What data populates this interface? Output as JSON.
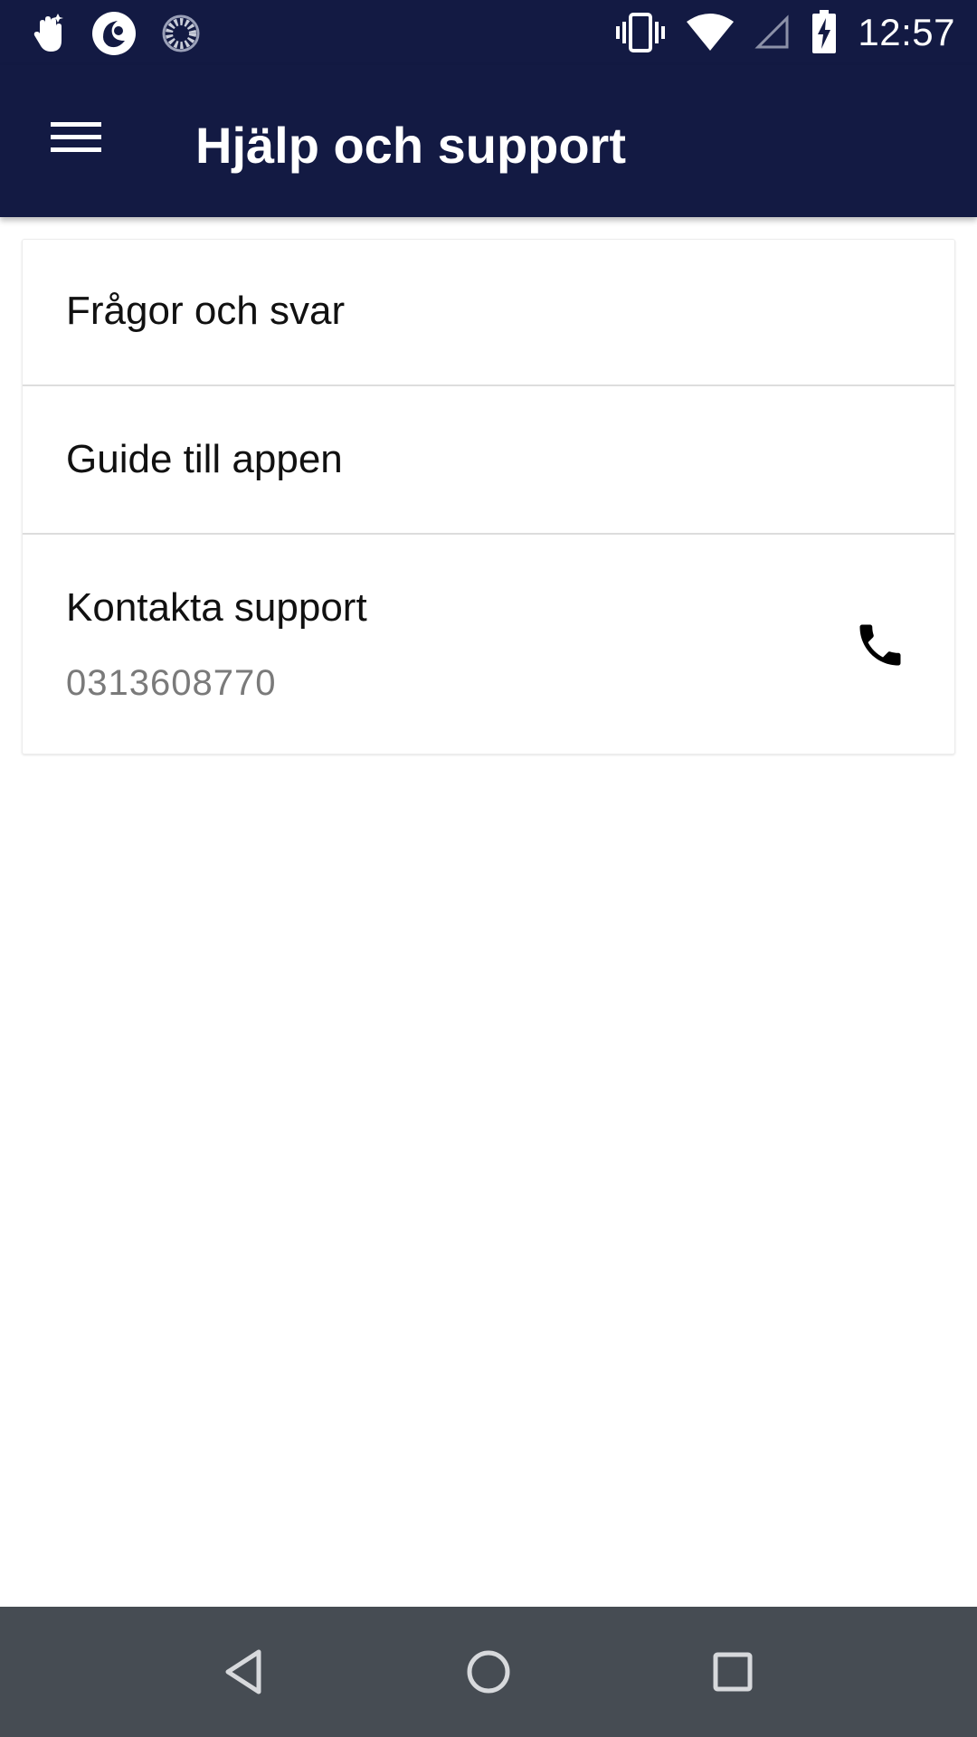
{
  "status_bar": {
    "time": "12:57",
    "left_icons": [
      "hand-notification-icon",
      "app-logo-notification-icon",
      "sync-spinner-icon"
    ],
    "right_icons": [
      "vibrate-icon",
      "wifi-icon",
      "cell-signal-icon",
      "battery-charging-icon"
    ]
  },
  "app_bar": {
    "title": "Hjälp och support",
    "menu_icon": "hamburger-menu-icon",
    "background": "#131a43"
  },
  "help_list": {
    "items": [
      {
        "title": "Frågor och svar"
      },
      {
        "title": "Guide till appen"
      },
      {
        "title": "Kontakta support",
        "subtitle": "0313608770",
        "action_icon": "phone-icon"
      }
    ]
  },
  "nav_bar": {
    "buttons": [
      "back-icon",
      "home-icon",
      "recents-icon"
    ],
    "background": "#464c53"
  }
}
